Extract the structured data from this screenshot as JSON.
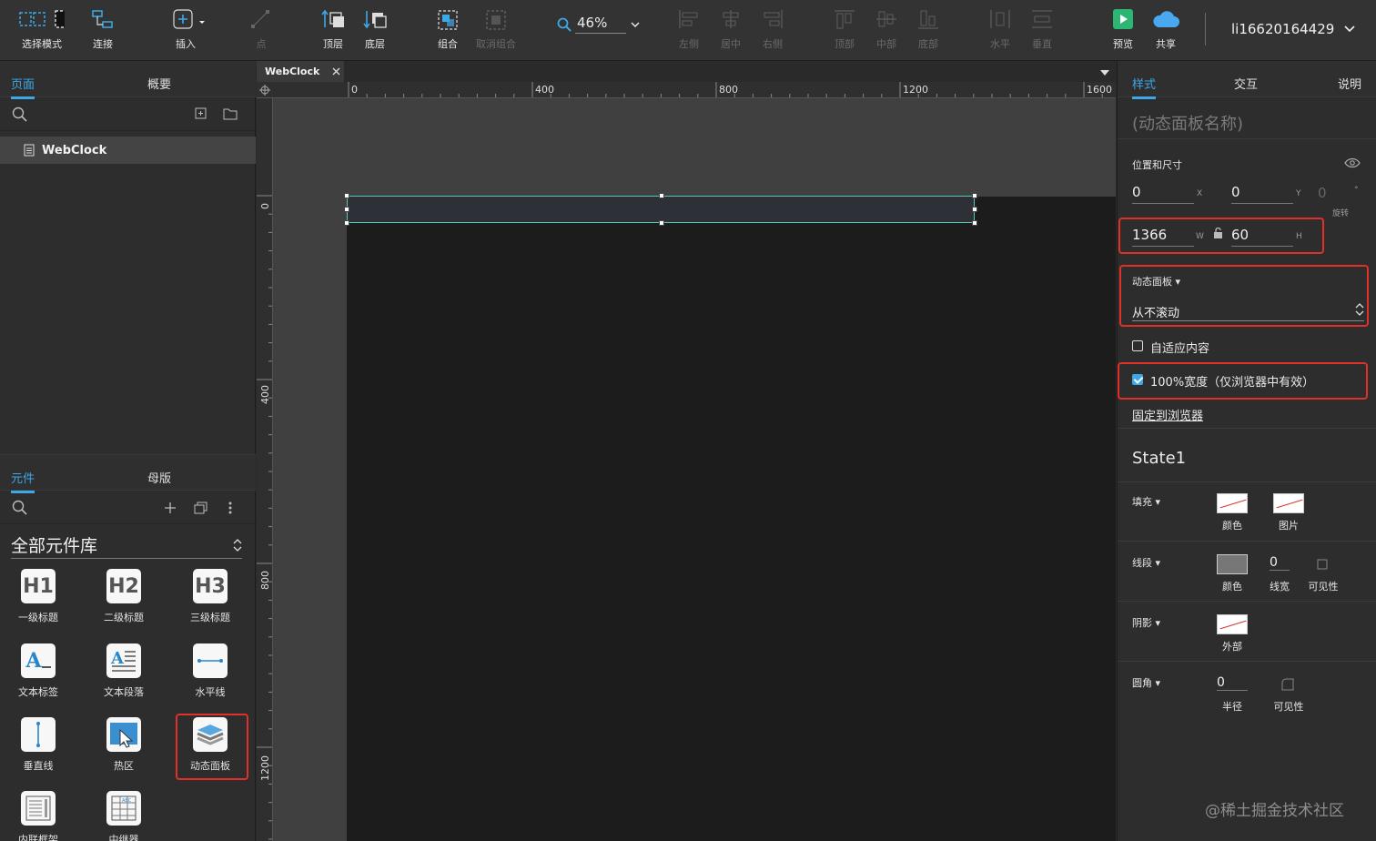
{
  "toolbar": {
    "select_mode": "选择模式",
    "connect": "连接",
    "insert": "插入",
    "point": "点",
    "bring_front": "顶层",
    "send_back": "底层",
    "group": "组合",
    "ungroup": "取消组合",
    "zoom": "46%",
    "align_left": "左侧",
    "align_center": "居中",
    "align_right": "右侧",
    "align_top": "顶部",
    "align_middle": "中部",
    "align_bottom": "底部",
    "dist_horizontal": "水平",
    "dist_vertical": "垂直",
    "preview": "预览",
    "share": "共享",
    "username": "li16620164429"
  },
  "left_panel": {
    "tabs": [
      "页面",
      "概要"
    ],
    "pages": [
      "WebClock"
    ],
    "bottom_tabs": [
      "元件",
      "母版"
    ],
    "library": "全部元件库",
    "widgets": [
      "一级标题",
      "二级标题",
      "三级标题",
      "文本标签",
      "文本段落",
      "水平线",
      "垂直线",
      "热区",
      "动态面板",
      "内联框架",
      "中继器"
    ]
  },
  "canvas": {
    "doc_tab": "WebClock",
    "hruler_labels": [
      "0",
      "400",
      "800",
      "1200",
      "1600"
    ],
    "vruler_labels": [
      "0",
      "400",
      "800",
      "1200"
    ]
  },
  "inspector": {
    "tabs": [
      "样式",
      "交互",
      "说明"
    ],
    "name_placeholder": "(动态面板名称)",
    "pos_size_label": "位置和尺寸",
    "x": "0",
    "x_label": "X",
    "y": "0",
    "y_label": "Y",
    "rotate": "0",
    "rotate_unit": "°",
    "rotate_label": "旋转",
    "w": "1366",
    "w_label": "W",
    "h": "60",
    "h_label": "H",
    "panel_label": "动态面板 ▾",
    "scroll_value": "从不滚动",
    "fit_content": "自适应内容",
    "full_width": "100%宽度（仅浏览器中有效）",
    "pin_browser": "固定到浏览器",
    "state": "State1",
    "fill_label": "填充 ▾",
    "fill_color": "颜色",
    "fill_image": "图片",
    "stroke_label": "线段 ▾",
    "stroke_color": "颜色",
    "stroke_width_value": "0",
    "stroke_width": "线宽",
    "stroke_visibility": "可见性",
    "shadow_label": "阴影 ▾",
    "shadow_outer": "外部",
    "radius_label": "圆角 ▾",
    "radius_value": "0",
    "radius": "半径",
    "radius_visibility": "可见性"
  },
  "watermark": "@稀土掘金技术社区",
  "colors": {
    "accent": "#3da7e8",
    "highlight": "#e0302a",
    "selection": "#55c8b5",
    "preview_green": "#2bb673",
    "share_blue": "#4aa8f0"
  }
}
